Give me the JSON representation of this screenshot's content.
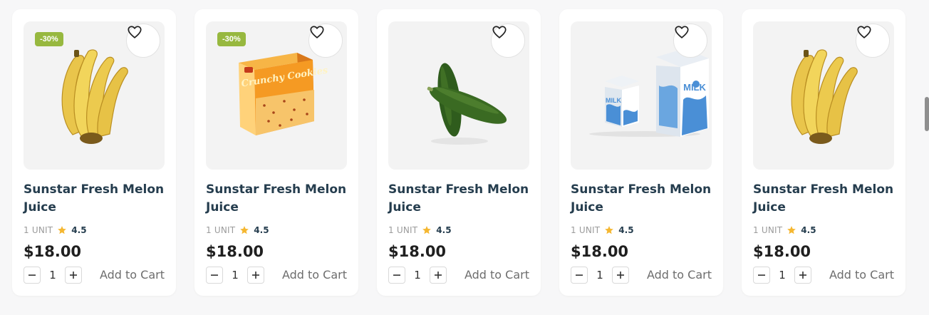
{
  "products": [
    {
      "title": "Sunstar Fresh Melon Juice",
      "badge": "-30%",
      "image": "bananas",
      "unit": "1 UNIT",
      "rating": "4.5",
      "price": "$18.00",
      "quantity": "1",
      "add_label": "Add to Cart"
    },
    {
      "title": "Sunstar Fresh Melon Juice",
      "badge": "-30%",
      "image": "crunchy-cookies-box",
      "unit": "1 UNIT",
      "rating": "4.5",
      "price": "$18.00",
      "quantity": "1",
      "add_label": "Add to Cart"
    },
    {
      "title": "Sunstar Fresh Melon Juice",
      "badge": "",
      "image": "cucumbers",
      "unit": "1 UNIT",
      "rating": "4.5",
      "price": "$18.00",
      "quantity": "1",
      "add_label": "Add to Cart"
    },
    {
      "title": "Sunstar Fresh Melon Juice",
      "badge": "",
      "image": "milk-cartons",
      "unit": "1 UNIT",
      "rating": "4.5",
      "price": "$18.00",
      "quantity": "1",
      "add_label": "Add to Cart"
    },
    {
      "title": "Sunstar Fresh Melon Juice",
      "badge": "",
      "image": "bananas",
      "unit": "1 UNIT",
      "rating": "4.5",
      "price": "$18.00",
      "quantity": "1",
      "add_label": "Add to Cart"
    }
  ],
  "image_text": {
    "cookies_brand": "Crunchy Cookies",
    "milk_big": "MILK",
    "milk_small": "MILK"
  },
  "icons": {
    "wishlist": "heart-icon",
    "rating": "star-icon",
    "minus": "minus-icon",
    "plus": "plus-icon"
  },
  "colors": {
    "badge": "#97b83f",
    "star": "#f5b731",
    "title": "#253d4e",
    "price": "#1f1f1f"
  }
}
